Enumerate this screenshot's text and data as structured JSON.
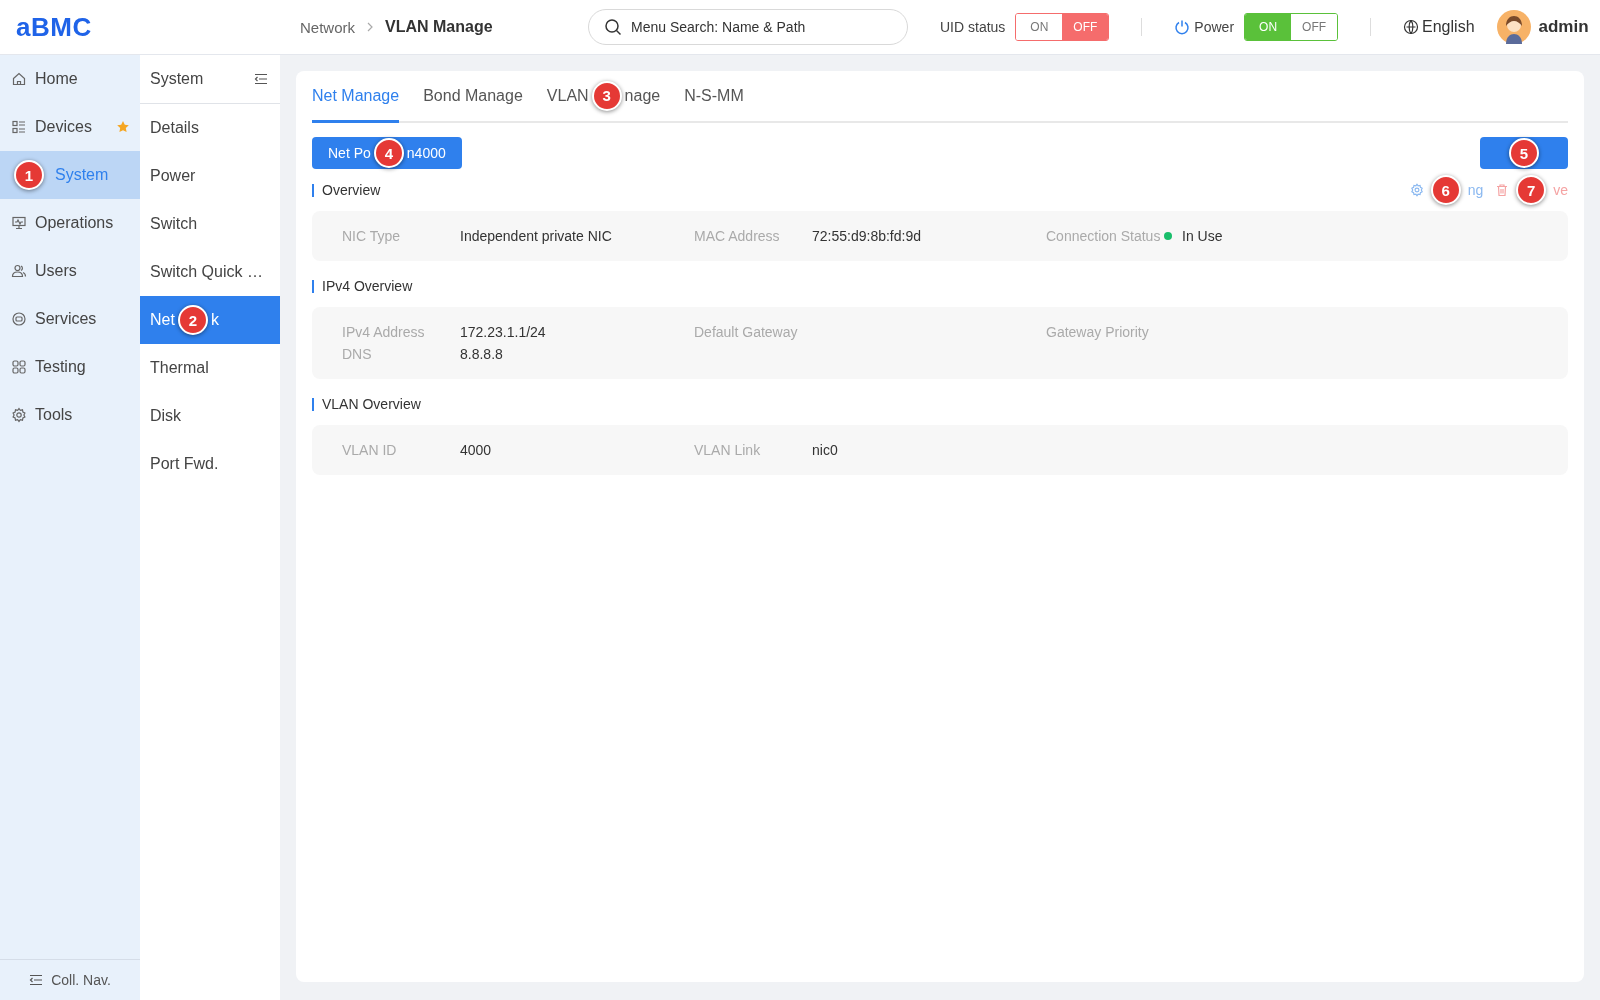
{
  "header": {
    "logo": "aBMC",
    "breadcrumb": [
      {
        "label": "Network",
        "current": false
      },
      {
        "label": "VLAN Manage",
        "current": true
      }
    ],
    "search": {
      "placeholder": "Menu Search: Name & Path"
    },
    "uid": {
      "label": "UID status",
      "options": [
        {
          "label": "ON",
          "selected": false
        },
        {
          "label": "OFF",
          "selected": true
        }
      ]
    },
    "power": {
      "label": "Power",
      "options": [
        {
          "label": "ON",
          "selected": true
        },
        {
          "label": "OFF",
          "selected": false
        }
      ]
    },
    "language": "English",
    "user": "admin"
  },
  "nav": {
    "items": [
      {
        "label": "Home",
        "selected": false,
        "starred": false
      },
      {
        "label": "Devices",
        "selected": false,
        "starred": true
      },
      {
        "segments": [
          {
            "kind": "marker",
            "text": "1"
          },
          {
            "kind": "text",
            "text": "System"
          }
        ],
        "selected": true,
        "starred": false
      },
      {
        "label": "Operations",
        "selected": false,
        "starred": false
      },
      {
        "label": "Users",
        "selected": false,
        "starred": false
      },
      {
        "label": "Services",
        "selected": false,
        "starred": false
      },
      {
        "label": "Testing",
        "selected": false,
        "starred": false
      },
      {
        "label": "Tools",
        "selected": false,
        "starred": false
      }
    ],
    "collapse": "Coll. Nav."
  },
  "subnav": {
    "title": "System",
    "items": [
      {
        "label": "Details",
        "selected": false
      },
      {
        "label": "Power",
        "selected": false
      },
      {
        "label": "Switch",
        "selected": false
      },
      {
        "label": "Switch Quick …",
        "selected": false
      },
      {
        "segments": [
          {
            "kind": "text",
            "text": "Net"
          },
          {
            "kind": "marker",
            "text": "2"
          },
          {
            "kind": "text",
            "text": "k"
          }
        ],
        "selected": true
      },
      {
        "label": "Thermal",
        "selected": false
      },
      {
        "label": "Disk",
        "selected": false
      },
      {
        "label": "Port Fwd.",
        "selected": false
      }
    ]
  },
  "tabs": [
    {
      "label": "Net Manage",
      "selected": true
    },
    {
      "label": "Bond Manage",
      "selected": false
    },
    {
      "segments": [
        {
          "kind": "text",
          "text": "VLAN"
        },
        {
          "kind": "marker",
          "text": "3"
        },
        {
          "kind": "text",
          "text": "nage"
        }
      ],
      "selected": false
    },
    {
      "label": "N-S-MM",
      "selected": false
    }
  ],
  "port_button": {
    "segments": [
      {
        "kind": "text",
        "text": "Net Po"
      },
      {
        "kind": "marker",
        "text": "4"
      },
      {
        "kind": "text",
        "text": "n4000"
      }
    ]
  },
  "right_button": {
    "segments": [
      {
        "kind": "marker",
        "text": "5"
      }
    ]
  },
  "sections": [
    {
      "title": "Overview",
      "actions": [
        {
          "kind": "setting",
          "segments": [
            {
              "kind": "marker",
              "text": "6"
            },
            {
              "kind": "text",
              "text": "ng"
            }
          ]
        },
        {
          "kind": "remove",
          "segments": [
            {
              "kind": "marker",
              "text": "7"
            },
            {
              "kind": "text",
              "text": "ve"
            }
          ]
        }
      ],
      "rows": [
        [
          {
            "label": "NIC Type",
            "value": "Independent private NIC"
          },
          {
            "label": "MAC Address",
            "value": "72:55:d9:8b:fd:9d"
          },
          {
            "label": "Connection Status",
            "value": "In Use",
            "color": "#19be6b"
          }
        ]
      ]
    },
    {
      "title": "IPv4 Overview",
      "rows": [
        [
          {
            "label": "IPv4 Address",
            "value": "172.23.1.1/24"
          },
          {
            "label": "Default Gateway"
          },
          {
            "label": "Gateway Priority"
          }
        ],
        [
          {
            "label": "DNS",
            "value": "8.8.8.8"
          }
        ]
      ]
    },
    {
      "title": "VLAN Overview",
      "rows": [
        [
          {
            "label": "VLAN ID",
            "value": "4000"
          },
          {
            "label": "VLAN Link",
            "value": "nic0"
          }
        ]
      ]
    }
  ]
}
